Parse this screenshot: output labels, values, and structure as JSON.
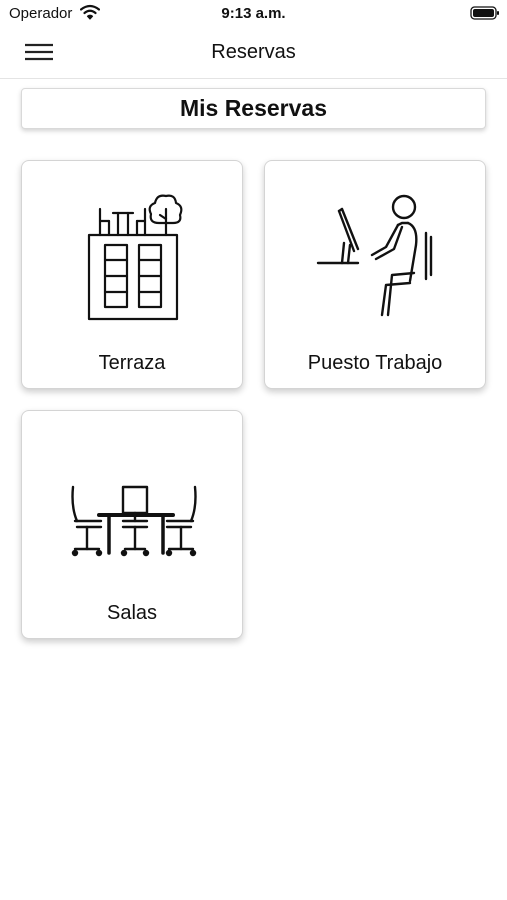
{
  "status_bar": {
    "carrier": "Operador",
    "time": "9:13 a.m.",
    "wifi_icon": "wifi-icon",
    "battery_icon": "battery-icon"
  },
  "nav": {
    "title": "Reservas",
    "menu_icon": "hamburger-menu-icon"
  },
  "header": {
    "title": "Mis Reservas"
  },
  "cards": [
    {
      "label": "Terraza",
      "icon": "terrace-building-icon"
    },
    {
      "label": "Puesto Trabajo",
      "icon": "workstation-person-icon"
    },
    {
      "label": "Salas",
      "icon": "meeting-room-icon"
    }
  ],
  "colors": {
    "background": "#ffffff",
    "text": "#111111",
    "card_border": "#d4d4d4"
  }
}
